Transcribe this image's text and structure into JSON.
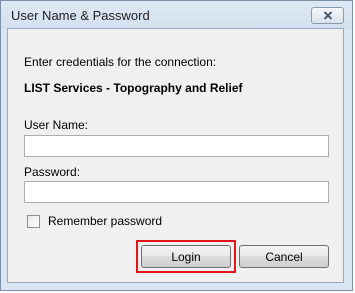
{
  "window": {
    "title": "User Name & Password"
  },
  "icons": {
    "close": "close-icon"
  },
  "dialog": {
    "description": "Enter credentials for the connection:",
    "connection_name": "LIST Services - Topography and Relief",
    "username_label": "User Name:",
    "username_value": "",
    "password_label": "Password:",
    "password_value": "",
    "remember_label": "Remember password",
    "remember_checked": false,
    "login_label": "Login",
    "cancel_label": "Cancel"
  },
  "colors": {
    "highlight": "#e3131b",
    "title_bg": "#dbe6f3"
  }
}
